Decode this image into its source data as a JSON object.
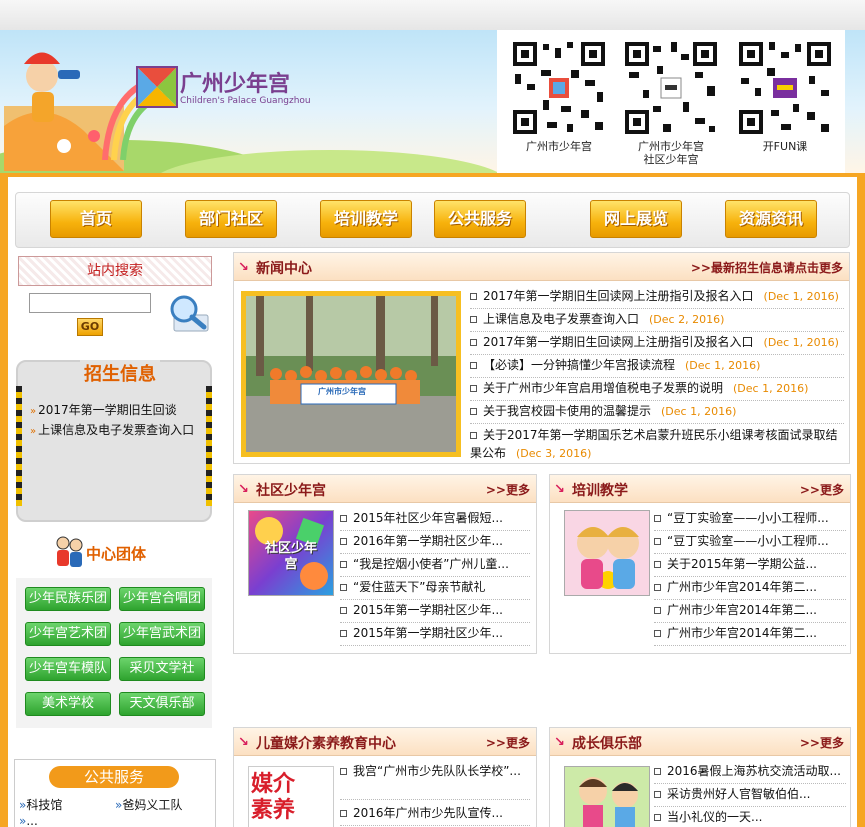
{
  "header": {
    "logo_cn": "广州少年宫",
    "logo_en": "Children's Palace Guangzhou",
    "qr_codes": [
      {
        "label": "广州市少年宫"
      },
      {
        "label": "广州市少年宫\n社区少年宫"
      },
      {
        "label": "开FUN课"
      }
    ]
  },
  "nav": {
    "items": [
      "首页",
      "部门社区",
      "培训教学",
      "公共服务",
      "网上展览",
      "资源资讯"
    ]
  },
  "sidebar": {
    "search_title": "站内搜索",
    "search_value": "",
    "go_label": "GO",
    "zhaosheng_title": "招生信息",
    "zhaosheng_items": [
      "2017年第一学期旧生回谈",
      "上课信息及电子发票查询入口"
    ],
    "tuanti_title": "中心团体",
    "groups": [
      "少年民族乐团",
      "少年宫合唱团",
      "少年宫艺术团",
      "少年宫武术团",
      "少年宫车模队",
      "采贝文学社",
      "美术学校",
      "天文俱乐部"
    ],
    "gonggong_title": "公共服务",
    "gonggong_links": [
      "科技馆",
      "爸妈义工队",
      "..."
    ]
  },
  "news": {
    "title": "新闻中心",
    "more": ">>最新招生信息请点击更多",
    "photo_banner": "广州市少年宫",
    "items": [
      {
        "text": "2017年第一学期旧生回读网上注册指引及报名入口",
        "date": "(Dec 1, 2016)"
      },
      {
        "text": "上课信息及电子发票查询入口",
        "date": "(Dec 2, 2016)"
      },
      {
        "text": "2017年第一学期旧生回读网上注册指引及报名入口",
        "date": "(Dec 1, 2016)"
      },
      {
        "text": "【必读】一分钟搞懂少年宫报读流程",
        "date": "(Dec 1, 2016)"
      },
      {
        "text": "关于广州市少年宫启用增值税电子发票的说明",
        "date": "(Dec 1, 2016)"
      },
      {
        "text": "关于我宫校园卡使用的温馨提示",
        "date": "(Dec 1, 2016)"
      },
      {
        "text": "关于2017年第一学期国乐艺术启蒙升班民乐小组课考核面试录取结果公布",
        "date": "(Dec 3, 2016)"
      }
    ]
  },
  "shequ": {
    "title": "社区少年宫",
    "more": ">>更多",
    "image_text": "社区少年宫",
    "items": [
      "2015年社区少年宫暑假短...",
      "2016年第一学期社区少年...",
      "“我是控烟小使者”广州儿童...",
      "“爱住蓝天下”母亲节献礼",
      "2015年第一学期社区少年...",
      "2015年第一学期社区少年..."
    ]
  },
  "peixun": {
    "title": "培训教学",
    "more": ">>更多",
    "items": [
      "“豆丁实验室——小小工程师...",
      "“豆丁实验室——小小工程师...",
      "关于2015年第一学期公益...",
      "广州市少年宫2014年第二...",
      "广州市少年宫2014年第二...",
      "广州市少年宫2014年第二..."
    ]
  },
  "meijie": {
    "title": "儿童媒介素养教育中心",
    "more": ">>更多",
    "image_text": "媒介素养",
    "items": [
      "我宫“广州市少先队队长学校”...",
      "2016年广州市少先队宣传..."
    ]
  },
  "chengzhang": {
    "title": "成长俱乐部",
    "more": ">>更多",
    "items": [
      "2016暑假上海苏杭交流活动取...",
      "采访贵州好人官智敏伯伯...",
      "当小礼仪的一天..."
    ]
  },
  "colors": {
    "orange_frame": "#f6a623",
    "title_red": "#8b1a1a",
    "date_orange": "#e88a00",
    "green_btn": "#2ea32e"
  }
}
